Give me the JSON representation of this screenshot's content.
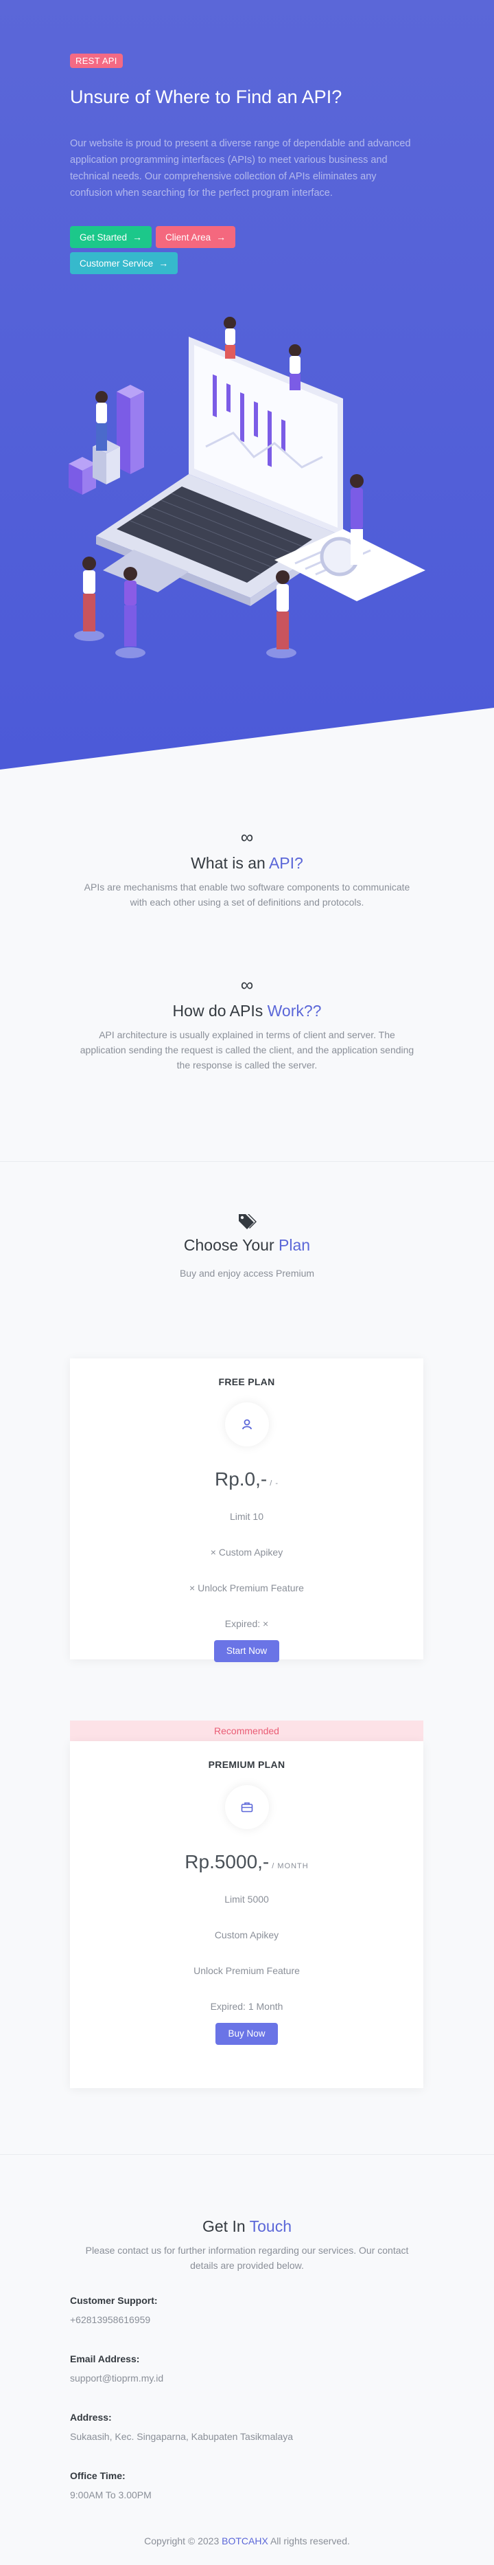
{
  "hero": {
    "badge": "REST API",
    "title": "Unsure of Where to Find an API?",
    "description": "Our website is proud to present a diverse range of dependable and advanced application programming interfaces (APIs) to meet various business and technical needs. Our comprehensive collection of APIs eliminates any confusion when searching for the perfect program interface.",
    "buttons": {
      "get_started": "Get Started",
      "client_area": "Client Area",
      "customer_service": "Customer Service"
    }
  },
  "what_is_api": {
    "title_plain": "What is an ",
    "title_accent": "API?",
    "text": "APIs are mechanisms that enable two software components to communicate with each other using a set of definitions and protocols."
  },
  "how_work": {
    "title_plain": "How do APIs ",
    "title_accent": "Work??",
    "text": "API architecture is usually explained in terms of client and server. The application sending the request is called the client, and the application sending the response is called the server."
  },
  "plans_section": {
    "title_plain": "Choose Your ",
    "title_accent": "Plan",
    "subtitle": "Buy and enjoy access Premium"
  },
  "free_plan": {
    "name": "FREE PLAN",
    "price": "Rp.0,-",
    "per": "/ -",
    "limit": "Limit 10",
    "custom_apikey": "× Custom Apikey",
    "unlock": "× Unlock Premium Feature",
    "expired": "Expired: ×",
    "button": "Start Now"
  },
  "premium_plan": {
    "recommended": "Recommended",
    "name": "PREMIUM PLAN",
    "price": "Rp.5000,-",
    "per": "/ MONTH",
    "limit": "Limit 5000",
    "custom_apikey": "Custom Apikey",
    "unlock": "Unlock Premium Feature",
    "expired": "Expired: 1 Month",
    "button": "Buy Now"
  },
  "contact": {
    "title_plain": "Get In ",
    "title_accent": "Touch",
    "text": "Please contact us for further information regarding our services. Our contact details are provided below.",
    "support_label": "Customer Support:",
    "support_value": "+62813958616959",
    "email_label": "Email Address:",
    "email_value": "support@tioprm.my.id",
    "address_label": "Address:",
    "address_value": "Sukaasih, Kec. Singaparna, Kabupaten Tasikmalaya",
    "office_label": "Office Time:",
    "office_value": "9:00AM To 3.00PM"
  },
  "footer": {
    "prefix": "Copyright © 2023 ",
    "brand": "BOTCAHX",
    "suffix": " All rights reserved."
  },
  "colors": {
    "hero_bg": "#5b67d8",
    "accent": "#5b67d8",
    "green": "#1cc88a",
    "pink": "#f4687e",
    "teal": "#36b9cc"
  }
}
